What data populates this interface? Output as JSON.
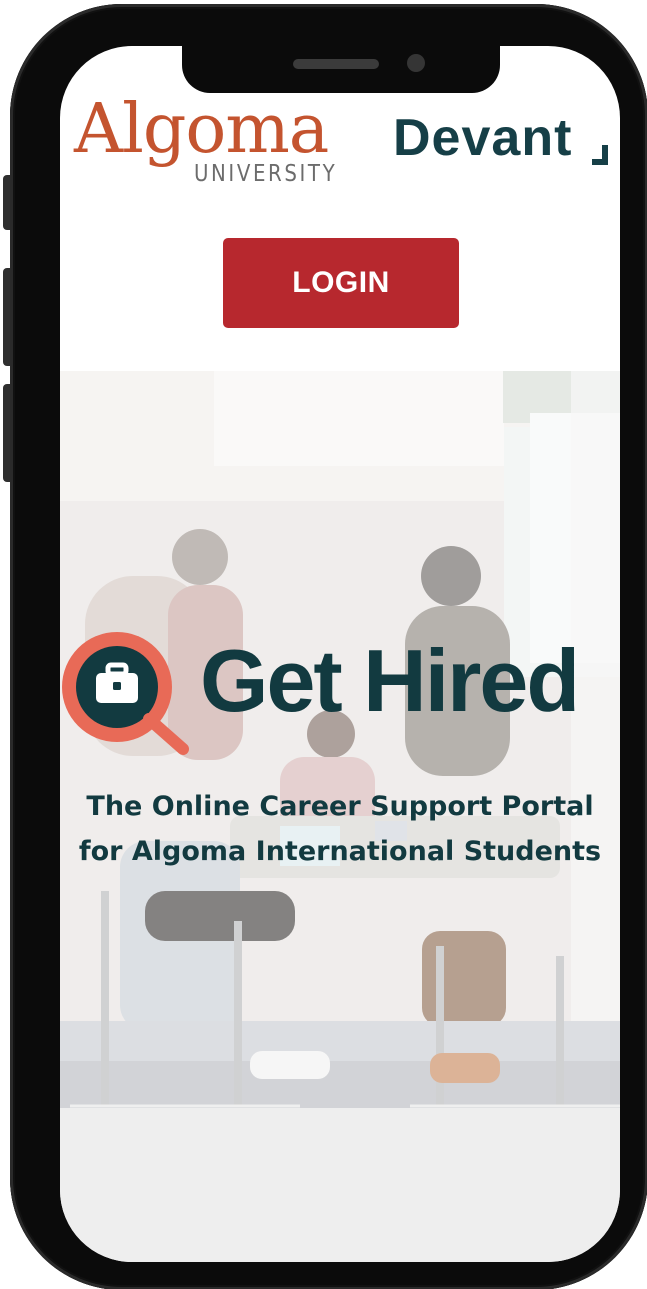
{
  "header": {
    "algoma_logo": {
      "word": "Algoma",
      "subword": "UNIVERSITY"
    },
    "devant_logo": {
      "word": "Devant"
    }
  },
  "actions": {
    "login_label": "LOGIN"
  },
  "hero": {
    "title": "Get Hired",
    "subtitle_line_1": "The Online Career Support Portal",
    "subtitle_line_2": "for Algoma International Students"
  },
  "colors": {
    "brand_red": "#b7282e",
    "algoma_orange": "#c4542f",
    "dark_teal": "#123a40",
    "magnifier_salmon": "#e86a57"
  },
  "icons": {
    "logo_icon": "magnifying-glass-briefcase-icon"
  }
}
